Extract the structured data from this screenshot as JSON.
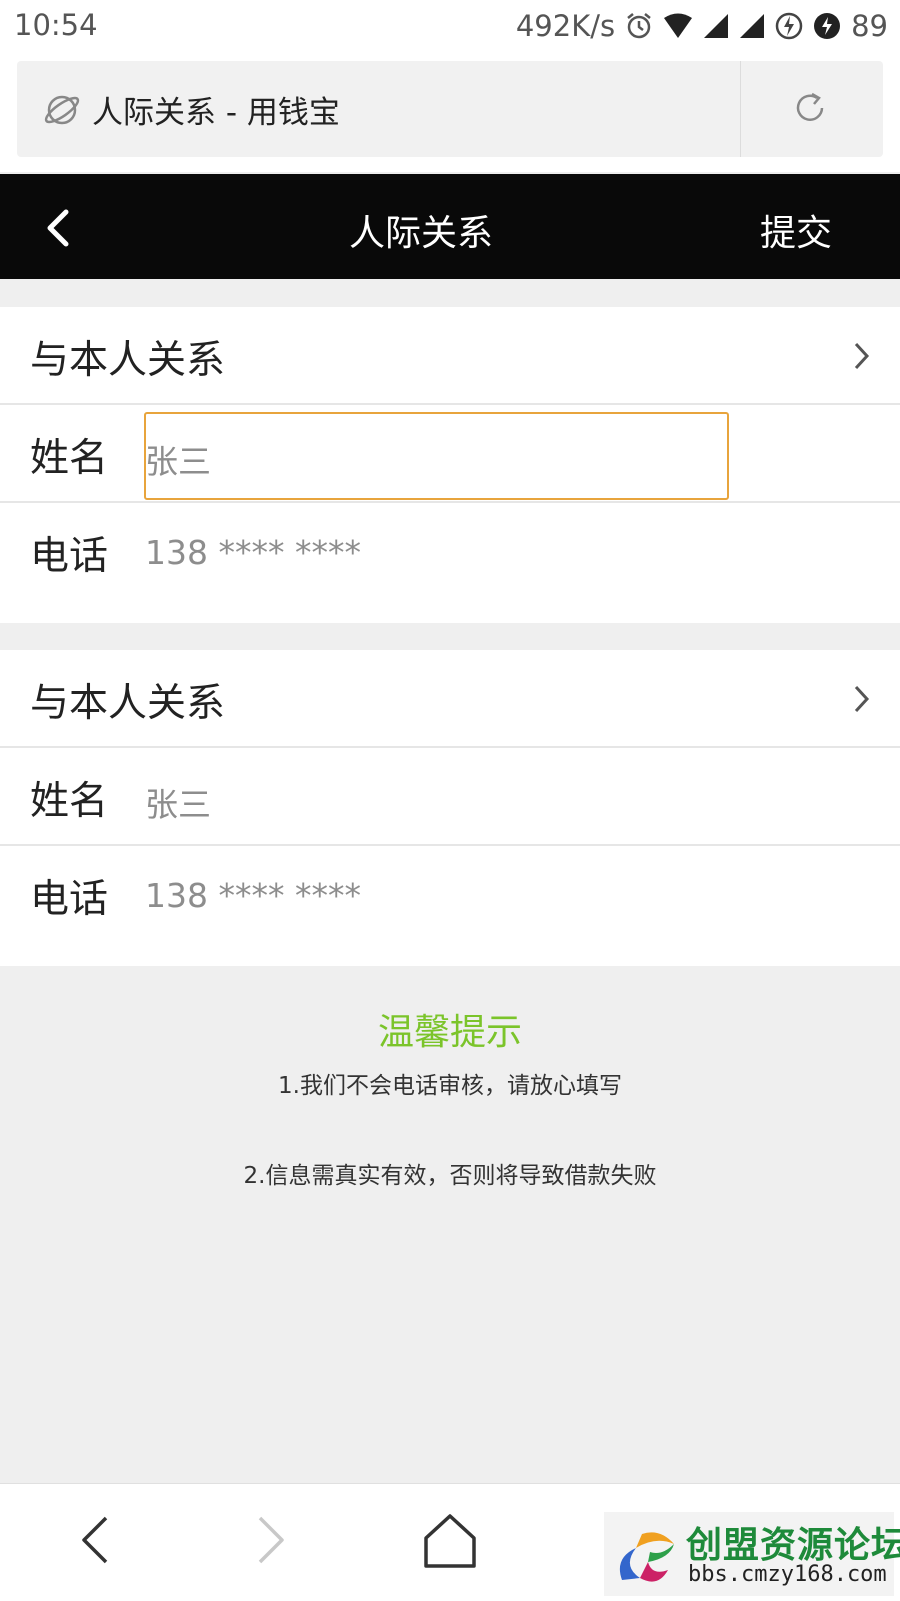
{
  "status_bar": {
    "time": "10:54",
    "speed": "492K/s",
    "battery": "89",
    "icons": [
      "alarm-icon",
      "wifi-icon",
      "signal-icon",
      "signal-icon",
      "charging-icon",
      "battery-icon"
    ]
  },
  "browser": {
    "page_title": "人际关系 - 用钱宝",
    "icons": [
      "globe-icon",
      "refresh-icon"
    ]
  },
  "header": {
    "title": "人际关系",
    "submit_label": "提交",
    "back_icon": "back-chevron-icon"
  },
  "contacts": [
    {
      "relation_label": "与本人关系",
      "name_label": "姓名",
      "name_placeholder": "张三",
      "phone_label": "电话",
      "phone_placeholder": "138 **** ****"
    },
    {
      "relation_label": "与本人关系",
      "name_label": "姓名",
      "name_placeholder": "张三",
      "phone_label": "电话",
      "phone_placeholder": "138 **** ****"
    }
  ],
  "tips": {
    "title": "温馨提示",
    "line1": "1.我们不会电话审核，请放心填写",
    "line2": "2.信息需真实有效，否则将导致借款失败"
  },
  "colors": {
    "header_bg": "#090909",
    "tip_title": "#7bc42a",
    "focus_border": "#e8a43c",
    "page_bg": "#efefef"
  },
  "bottom_nav": [
    "back-arrow-icon",
    "forward-arrow-icon",
    "home-icon"
  ],
  "watermark": {
    "title": "创盟资源论坛",
    "url": "bbs.cmzy168.com"
  }
}
